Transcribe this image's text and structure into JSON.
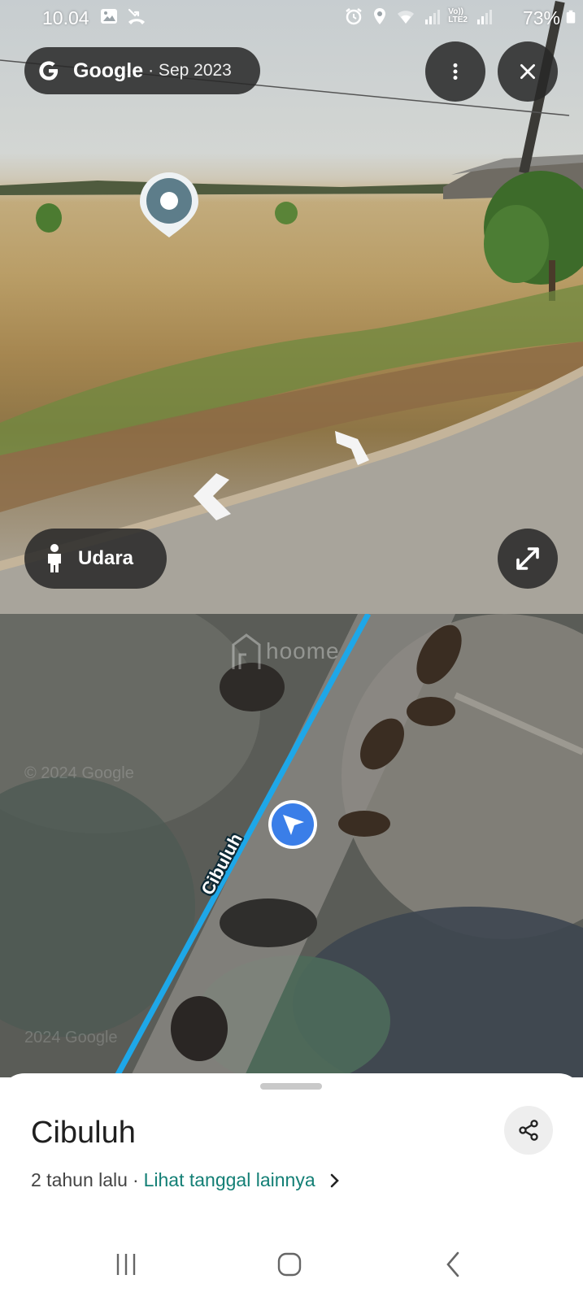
{
  "status_bar": {
    "time": "10.04",
    "battery": "73%",
    "left_icons": [
      "image-icon",
      "missed-call-icon"
    ],
    "right_icons": [
      "alarm-icon",
      "location-icon",
      "wifi-icon",
      "signal-icon",
      "volte-icon",
      "signal-icon-2",
      "battery-icon"
    ],
    "volte_line1": "Vo))",
    "volte_line2": "LTE2"
  },
  "street_view": {
    "brand": "Google",
    "date": "· Sep 2023",
    "more_icon": "more-vert-icon",
    "close_icon": "close-icon",
    "mode_label": "Udara",
    "mode_icon": "pegman-icon",
    "expand_icon": "expand-icon",
    "nav_arrows": [
      "arrow-left-icon",
      "arrow-right-icon"
    ]
  },
  "map": {
    "watermark": "hoome",
    "road_label": "Cibuluh",
    "faint_text_1": "© 2024 Google",
    "faint_text_2": "2024 Google",
    "road_color": "#1ea7e8",
    "location_marker_color": "#3a7ee8"
  },
  "sheet": {
    "title": "Cibuluh",
    "age": "2 tahun lalu",
    "separator": "·",
    "see_dates": "Lihat tanggal lainnya",
    "share_icon": "share-icon",
    "accent_color": "#137f75"
  },
  "nav_bar": {
    "recent_icon": "recent-apps-icon",
    "home_icon": "home-icon",
    "back_icon": "back-icon"
  }
}
